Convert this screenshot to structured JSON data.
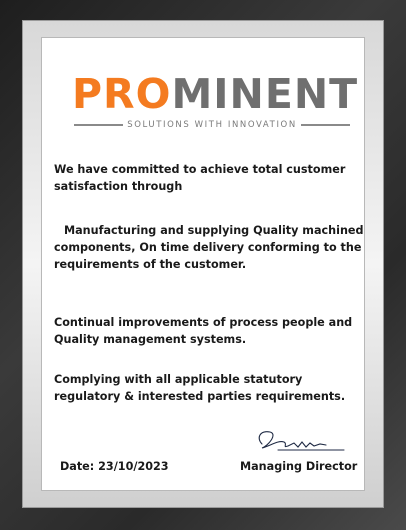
{
  "logo": {
    "word_part1": "PRO",
    "word_part2": "MINENT",
    "tagline": "SOLUTIONS WITH INNOVATION",
    "color_primary": "#f47b20",
    "color_secondary": "#6f6f6f"
  },
  "policy": {
    "paragraphs": [
      "We have committed to achieve total customer satisfaction through",
      "Manufacturing and supplying Quality machined components, On time delivery conforming to the requirements of the customer.",
      "Continual improvements of process people and Quality management systems.",
      "Complying with all applicable statutory regulatory & interested parties requirements."
    ]
  },
  "footer": {
    "date": "Date: 23/10/2023",
    "signatory": "Managing Director"
  }
}
